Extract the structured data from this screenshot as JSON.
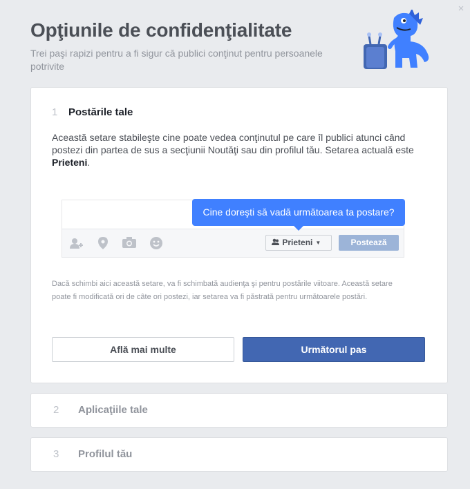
{
  "dialog": {
    "close_symbol": "×",
    "title": "Opţiunile de confidenţialitate",
    "subtitle": "Trei paşi rapizi pentru a fi sigur că publici conţinut pentru persoanele potrivite",
    "illustration": "blue-dinosaur-mascot",
    "accent_color": "#4267b2",
    "tooltip_color": "#4080ff"
  },
  "steps": [
    {
      "number": "1",
      "title": "Postările tale",
      "desc_text": "Această setare stabileşte cine poate vedea conţinutul pe care îl publici atunci când postezi din partea de sus a secţiunii Noutăţi sau din profilul tău. Setarea actuală este ",
      "desc_bold": "Prieteni",
      "desc_end": ".",
      "tooltip": "Cine doreşti să vadă următoarea ta postare?",
      "composer": {
        "icons": [
          "tag-friends-icon",
          "location-pin-icon",
          "camera-icon",
          "smiley-icon"
        ],
        "audience_label": "Prieteni",
        "post_label": "Postează"
      },
      "note": "Dacă schimbi aici această setare, va fi schimbată audienţa şi pentru postările viitoare. Această setare poate fi modificată ori de câte ori postezi, iar setarea va fi păstrată pentru următoarele postări.",
      "learn_more": "Află mai multe",
      "next": "Următorul pas"
    },
    {
      "number": "2",
      "title": "Aplicaţiile tale"
    },
    {
      "number": "3",
      "title": "Profilul tău"
    }
  ]
}
